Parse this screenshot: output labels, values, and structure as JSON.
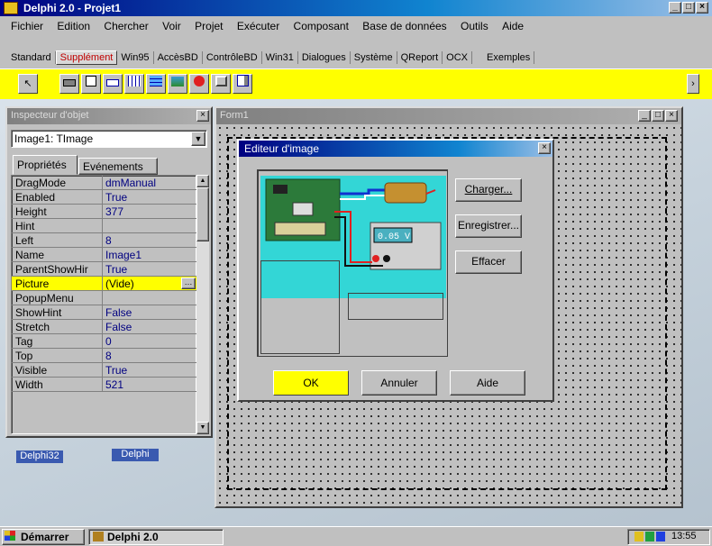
{
  "window": {
    "title": "Delphi 2.0 - Projet1"
  },
  "menu": [
    "Fichier",
    "Edition",
    "Chercher",
    "Voir",
    "Projet",
    "Exécuter",
    "Composant",
    "Base de données",
    "Outils",
    "Aide"
  ],
  "palette": {
    "tabs": [
      "Standard",
      "Supplément",
      "Win95",
      "AccèsBD",
      "ContrôleBD",
      "Win31",
      "Dialogues",
      "Système",
      "QReport",
      "OCX",
      "Exemples"
    ],
    "active": "Supplément",
    "icons": [
      "pointer-icon",
      "bitbtn-icon",
      "speedbutton-icon",
      "maskedit-icon",
      "stringgrid-icon",
      "drawgrid-icon",
      "image-icon",
      "shape-icon",
      "bevel-icon",
      "scrollbox-icon"
    ]
  },
  "inspector": {
    "title": "Inspecteur d'objet",
    "object": "Image1: TImage",
    "tab_properties": "Propriétés",
    "tab_events": "Evénements",
    "properties": [
      {
        "name": "DragMode",
        "value": "dmManual"
      },
      {
        "name": "Enabled",
        "value": "True"
      },
      {
        "name": "Height",
        "value": "377"
      },
      {
        "name": "Hint",
        "value": ""
      },
      {
        "name": "Left",
        "value": "8"
      },
      {
        "name": "Name",
        "value": "Image1"
      },
      {
        "name": "ParentShowHir",
        "value": "True"
      },
      {
        "name": "Picture",
        "value": "(Vide)"
      },
      {
        "name": "PopupMenu",
        "value": ""
      },
      {
        "name": "ShowHint",
        "value": "False"
      },
      {
        "name": "Stretch",
        "value": "False"
      },
      {
        "name": "Tag",
        "value": "0"
      },
      {
        "name": "Top",
        "value": "8"
      },
      {
        "name": "Visible",
        "value": "True"
      },
      {
        "name": "Width",
        "value": "521"
      }
    ],
    "selected": "Picture"
  },
  "form": {
    "title": "Form1"
  },
  "image_editor": {
    "title": "Editeur d'image",
    "load": "Charger...",
    "save": "Enregistrer...",
    "clear": "Effacer",
    "ok": "OK",
    "cancel": "Annuler",
    "help": "Aide",
    "lcd_value": "0.05 V"
  },
  "desktop": {
    "icons": [
      "Delphi32",
      "Delphi"
    ]
  },
  "taskbar": {
    "start": "Démarrer",
    "task": "Delphi 2.0",
    "clock": "13:55"
  },
  "colors": {
    "highlight": "#ffff00",
    "title_active": "#000080",
    "cyan": "#33d6d6"
  }
}
